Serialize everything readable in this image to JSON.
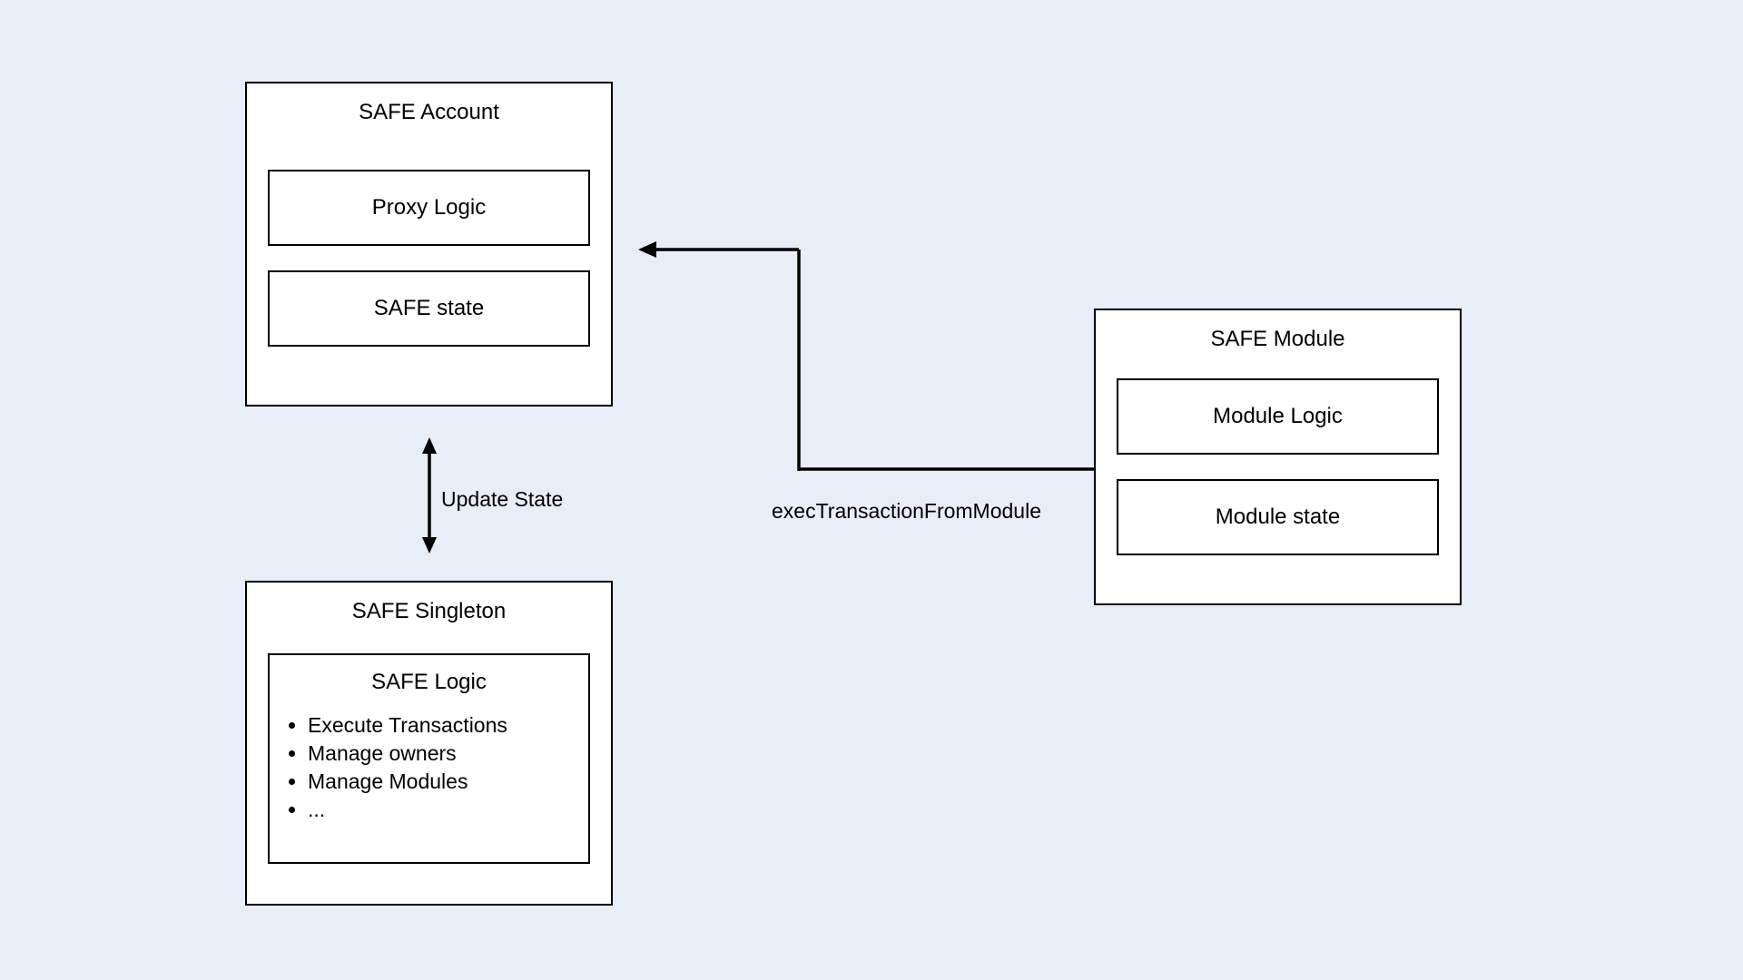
{
  "account": {
    "title": "SAFE Account",
    "proxy": "Proxy Logic",
    "state": "SAFE state"
  },
  "singleton": {
    "title": "SAFE Singleton",
    "logic_title": "SAFE Logic",
    "items": {
      "0": "Execute Transactions",
      "1": "Manage owners",
      "2": "Manage Modules",
      "3": "..."
    }
  },
  "module": {
    "title": "SAFE Module",
    "logic": "Module Logic",
    "state": "Module state"
  },
  "labels": {
    "update_state": "Update State",
    "exec_tx": "execTransactionFromModule"
  }
}
